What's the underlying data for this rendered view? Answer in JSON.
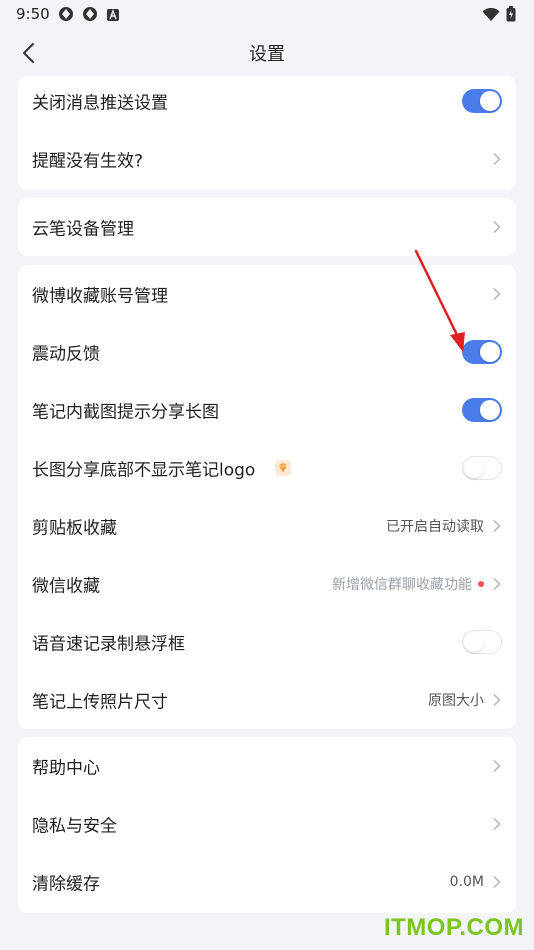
{
  "status_bar": {
    "time": "9:50",
    "left_icons": [
      "app-notification-icon",
      "app-notification-icon",
      "text-badge-icon"
    ],
    "right_icons": [
      "wifi-icon",
      "battery-icon"
    ]
  },
  "nav": {
    "title": "设置",
    "back_icon": "back-arrow-icon"
  },
  "cards": [
    {
      "rows": [
        {
          "label": "关闭消息推送设置",
          "control": "toggle",
          "on": true
        },
        {
          "label": "提醒没有生效?",
          "control": "chevron"
        }
      ]
    },
    {
      "rows": [
        {
          "label": "云笔设备管理",
          "control": "chevron"
        }
      ]
    },
    {
      "rows": [
        {
          "label": "微博收藏账号管理",
          "control": "chevron"
        },
        {
          "label": "震动反馈",
          "control": "toggle",
          "on": true
        },
        {
          "label": "笔记内截图提示分享长图",
          "control": "toggle",
          "on": true
        },
        {
          "label": "长图分享底部不显示笔记logo",
          "control": "toggle",
          "on": false,
          "badge": "vip-diamond-icon"
        },
        {
          "label": "剪贴板收藏",
          "control": "chevron",
          "value": "已开启自动读取"
        },
        {
          "label": "微信收藏",
          "control": "chevron",
          "value": "新增微信群聊收藏功能",
          "dot": true
        },
        {
          "label": "语音速记录制悬浮框",
          "control": "toggle",
          "on": false
        },
        {
          "label": "笔记上传照片尺寸",
          "control": "chevron",
          "value": "原图大小"
        }
      ]
    },
    {
      "rows": [
        {
          "label": "帮助中心",
          "control": "chevron"
        },
        {
          "label": "隐私与安全",
          "control": "chevron"
        },
        {
          "label": "清除缓存",
          "control": "chevron",
          "value": "0.0M"
        }
      ]
    }
  ],
  "colors": {
    "accent": "#4a7de9",
    "background": "#f3f4f7",
    "card": "#ffffff",
    "annotation_arrow": "#e02020",
    "watermark": "#7bc61e"
  },
  "watermark": "ITMOP.COM"
}
